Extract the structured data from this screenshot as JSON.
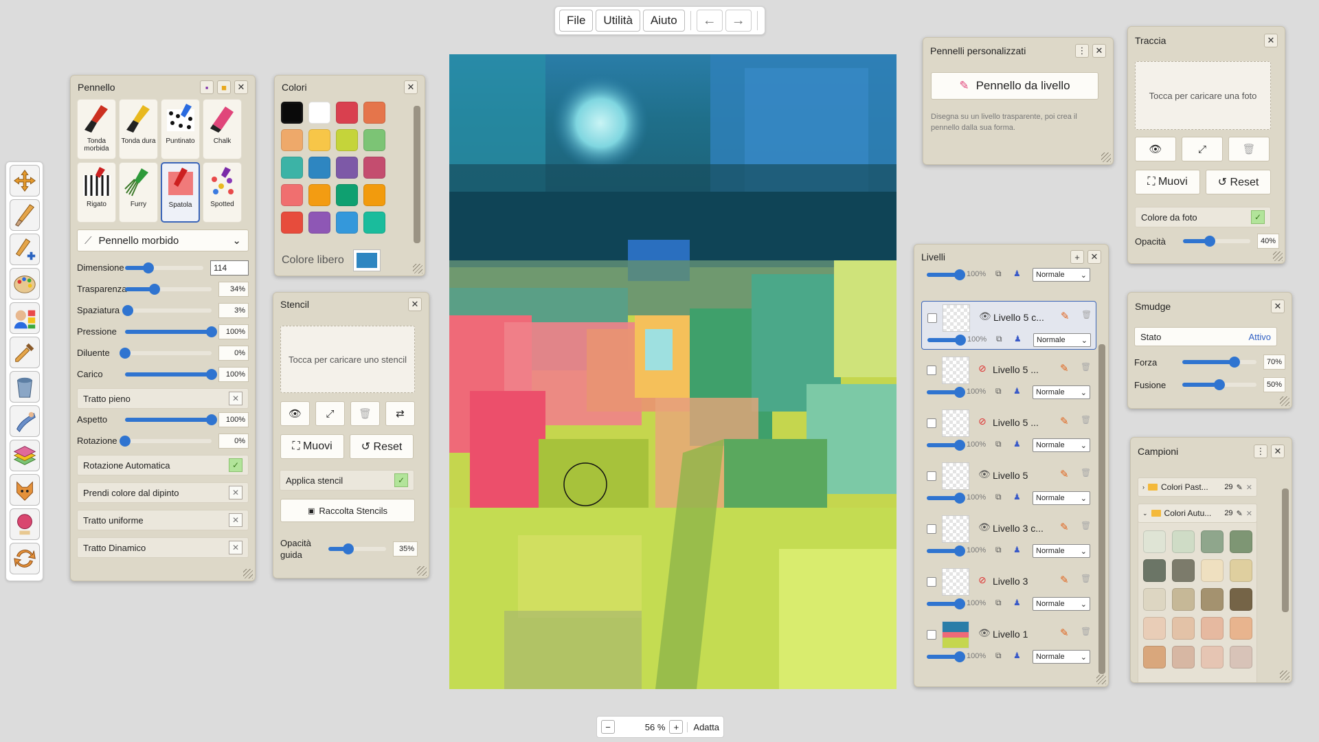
{
  "menu": {
    "file": "File",
    "utilita": "Utilità",
    "aiuto": "Aiuto",
    "undo": "←",
    "redo": "→"
  },
  "zoom": {
    "minus": "−",
    "value": "56 %",
    "plus": "+",
    "fit": "Adatta"
  },
  "brush_panel": {
    "title": "Pennello",
    "brushes": [
      {
        "label": "Tonda morbida"
      },
      {
        "label": "Tonda dura"
      },
      {
        "label": "Puntinato"
      },
      {
        "label": "Chalk"
      },
      {
        "label": "Rigato"
      },
      {
        "label": "Furry"
      },
      {
        "label": "Spatola"
      },
      {
        "label": "Spotted"
      }
    ],
    "preset": "Pennello morbido",
    "dimensione": {
      "label": "Dimensione",
      "value": "114",
      "fraction": 0.3
    },
    "trasparenza": {
      "label": "Trasparenza",
      "value": "34%",
      "fraction": 0.34
    },
    "spaziatura": {
      "label": "Spaziatura",
      "value": "3%",
      "fraction": 0.03
    },
    "pressione": {
      "label": "Pressione",
      "value": "100%",
      "fraction": 1.0
    },
    "diluente": {
      "label": "Diluente",
      "value": "0%",
      "fraction": 0.0
    },
    "carico": {
      "label": "Carico",
      "value": "100%",
      "fraction": 1.0
    },
    "tratto_pieno": "Tratto pieno",
    "aspetto": {
      "label": "Aspetto",
      "value": "100%",
      "fraction": 1.0
    },
    "rotazione": {
      "label": "Rotazione",
      "value": "0%",
      "fraction": 0.0
    },
    "rotazione_auto": "Rotazione Automatica",
    "prendi_colore": "Prendi colore dal dipinto",
    "tratto_uniforme": "Tratto uniforme",
    "tratto_dinamico": "Tratto Dinamico"
  },
  "colors_panel": {
    "title": "Colori",
    "swatches": [
      "#0a0a0a",
      "#ffffff",
      "#d9404f",
      "#e5754b",
      "#eea96a",
      "#f7c648",
      "#c5d43a",
      "#7cc475",
      "#3cb3a6",
      "#2e86c1",
      "#7d59a7",
      "#c44d6f",
      "#f06f6f",
      "#f39c12",
      "#0fa070",
      "#f29b0d",
      "#e74c3c",
      "#8e57b5",
      "#3498db",
      "#1abc9c"
    ],
    "free_label": "Colore libero",
    "free_color": "#2e86c1"
  },
  "stencil_panel": {
    "title": "Stencil",
    "upload": "Tocca per caricare uno stencil",
    "muovi": "⛶ Muovi",
    "reset": "↺ Reset",
    "applica": "Applica stencil",
    "raccolta": "Raccolta Stencils",
    "opacita_label": "Opacità guida",
    "opacita_value": "35%",
    "opacita_fraction": 0.35
  },
  "custom_brushes": {
    "title": "Pennelli personalizzati",
    "button": "Pennello da livello",
    "hint": "Disegna su un livello trasparente, poi crea il pennello dalla sua forma."
  },
  "trace_panel": {
    "title": "Traccia",
    "upload": "Tocca per caricare una foto",
    "muovi": "⛶ Muovi",
    "reset": "↺ Reset",
    "colore_foto": "Colore da foto",
    "opacita_label": "Opacità",
    "opacita_value": "40%",
    "opacita_fraction": 0.4
  },
  "smudge_panel": {
    "title": "Smudge",
    "stato_label": "Stato",
    "stato_value": "Attivo",
    "forza_label": "Forza",
    "forza_value": "70%",
    "forza_fraction": 0.7,
    "fusione_label": "Fusione",
    "fusione_value": "50%",
    "fusione_fraction": 0.5
  },
  "layers_panel": {
    "title": "Livelli",
    "top_opacity": "100%",
    "top_blend": "Normale",
    "layers": [
      {
        "name": "Livello 5 c...",
        "opacity": "100%",
        "blend": "Normale",
        "visible": true,
        "selected": true
      },
      {
        "name": "Livello 5 ...",
        "opacity": "100%",
        "blend": "Normale",
        "visible": false,
        "selected": false
      },
      {
        "name": "Livello 5 ...",
        "opacity": "100%",
        "blend": "Normale",
        "visible": false,
        "selected": false
      },
      {
        "name": "Livello 5",
        "opacity": "100%",
        "blend": "Normale",
        "visible": true,
        "selected": false
      },
      {
        "name": "Livello 3 c...",
        "opacity": "100%",
        "blend": "Normale",
        "visible": true,
        "selected": false
      },
      {
        "name": "Livello 3",
        "opacity": "100%",
        "blend": "Normale",
        "visible": false,
        "selected": false
      },
      {
        "name": "Livello 1",
        "opacity": "100%",
        "blend": "Normale",
        "visible": true,
        "selected": false
      }
    ]
  },
  "samples_panel": {
    "title": "Campioni",
    "palettes": [
      {
        "name": "Colori Past...",
        "count": "29"
      },
      {
        "name": "Colori Autu...",
        "count": "29"
      }
    ],
    "swatches": [
      "#dfe4d5",
      "#cfdcc6",
      "#8fa68c",
      "#7e9674",
      "#6b7566",
      "#7c7b6b",
      "#efe0c0",
      "#dfcf9f",
      "#ddd6c2",
      "#c6b897",
      "#a4926f",
      "#756447",
      "#e9cdb7",
      "#e3c2a7",
      "#e6b9a0",
      "#e8b48e",
      "#d9a77c",
      "#d7b7a3",
      "#e6c5b3",
      "#d8c3b8"
    ]
  }
}
